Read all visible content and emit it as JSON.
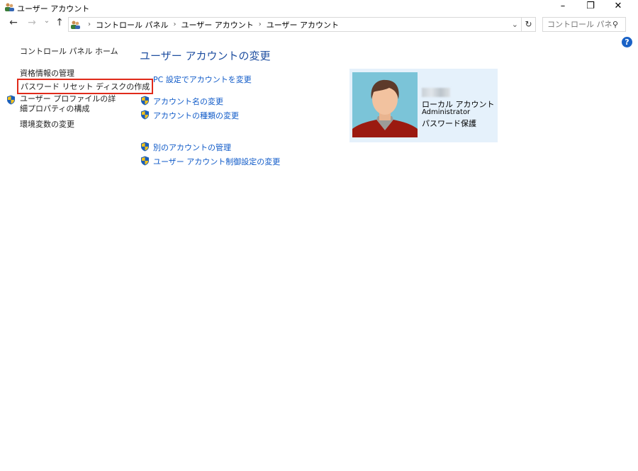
{
  "window": {
    "title": "ユーザー アカウント",
    "minimize": "–",
    "restore": "❐",
    "close": "✕"
  },
  "nav": {
    "back": "←",
    "forward": "→",
    "recent": "⌄",
    "up": "↑"
  },
  "breadcrumb": [
    "コントロール パネル",
    "ユーザー アカウント",
    "ユーザー アカウント"
  ],
  "address": {
    "dropdown": "⌄",
    "refresh": "↻"
  },
  "search": {
    "placeholder": "コントロール パネル..."
  },
  "help": "?",
  "sidebar": {
    "home": "コントロール パネル ホーム",
    "items": [
      "資格情報の管理",
      "パスワード リセット ディスクの作成",
      "ユーザー プロファイルの詳細プロパティの構成",
      "環境変数の変更"
    ]
  },
  "main": {
    "heading": "ユーザー アカウントの変更",
    "pc_settings": "PC 設定でアカウントを変更",
    "links": [
      "アカウント名の変更",
      "アカウントの種類の変更",
      "別のアカウントの管理",
      "ユーザー アカウント制御設定の変更"
    ]
  },
  "account": {
    "type": "ローカル アカウント",
    "role": "Administrator",
    "protection": "パスワード保護"
  },
  "colors": {
    "link": "#0f5ac8",
    "heading": "#1e4ea0",
    "highlight": "#e02a1a",
    "card": "#e5f1fb"
  }
}
